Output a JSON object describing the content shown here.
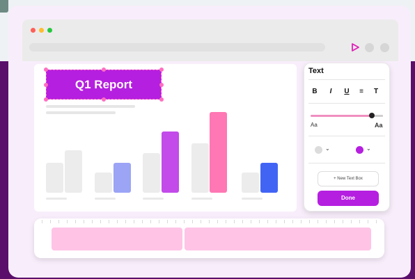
{
  "slide": {
    "title": "Q1 Report"
  },
  "chart_data": {
    "type": "bar",
    "categories": [
      "1",
      "2",
      "3",
      "4",
      "5"
    ],
    "series": [
      {
        "values": [
          44,
          29,
          58,
          72,
          29
        ]
      },
      {
        "values": [
          62,
          44,
          90,
          118,
          44
        ]
      }
    ],
    "colors": [
      "#ececec",
      "#9ba4f5",
      "#c24bea",
      "#ff77b4",
      "#4264f5"
    ],
    "ylim": [
      0,
      120
    ],
    "grid": false
  },
  "text_panel": {
    "title": "Text",
    "format_buttons": [
      "B",
      "I",
      "U",
      "≡",
      "T"
    ],
    "font_size_level": 0.86,
    "size_small_label": "Aa",
    "size_large_label": "Aa",
    "colors": {
      "swatch_1": "#dcdcdc",
      "swatch_2": "#b51fe0"
    },
    "new_text_box_label": "+ New Text Box",
    "done_label": "Done"
  },
  "window": {
    "traffic_colors": [
      "#ff5f57",
      "#febc2e",
      "#28c840"
    ]
  },
  "timeline": {
    "clips": 2
  },
  "colors": {
    "accent": "#b51fe0",
    "pink": "#ff77b4",
    "clip": "#ffc3e6"
  }
}
